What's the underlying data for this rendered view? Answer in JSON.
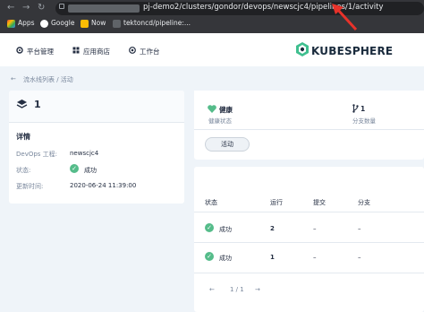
{
  "browser": {
    "url": "pj-demo2/clusters/gondor/devops/newscjc4/pipelines/1/activity",
    "bookmarks": [
      "Apps",
      "Google",
      "Now",
      "tektoncd/pipeline:..."
    ]
  },
  "topnav": {
    "platform": "平台管理",
    "appstore": "应用商店",
    "workbench": "工作台"
  },
  "logo_text": "KUBESPHERE",
  "breadcrumb": "流水线列表 / 活动",
  "run": {
    "number": "1",
    "detail_title": "详情",
    "fields": [
      {
        "key": "DevOps 工程:",
        "value": "newscjc4"
      },
      {
        "key": "状态:",
        "value": "成功"
      },
      {
        "key": "更新时间:",
        "value": "2020-06-24 11:39:00"
      }
    ]
  },
  "health": {
    "value": "健康",
    "label": "健康状态"
  },
  "branches": {
    "value": "1",
    "label": "分支数量"
  },
  "tab_label": "活动",
  "table": {
    "headers": [
      "状态",
      "运行",
      "提交",
      "分支"
    ],
    "rows": [
      {
        "status": "成功",
        "run": "2",
        "commit": "–",
        "branch": "–"
      },
      {
        "status": "成功",
        "run": "1",
        "commit": "–",
        "branch": "–"
      }
    ],
    "pager": "1 / 1"
  },
  "colors": {
    "success": "#55bc8a",
    "annotation": "#e8322a",
    "chrome": "#35363a"
  }
}
